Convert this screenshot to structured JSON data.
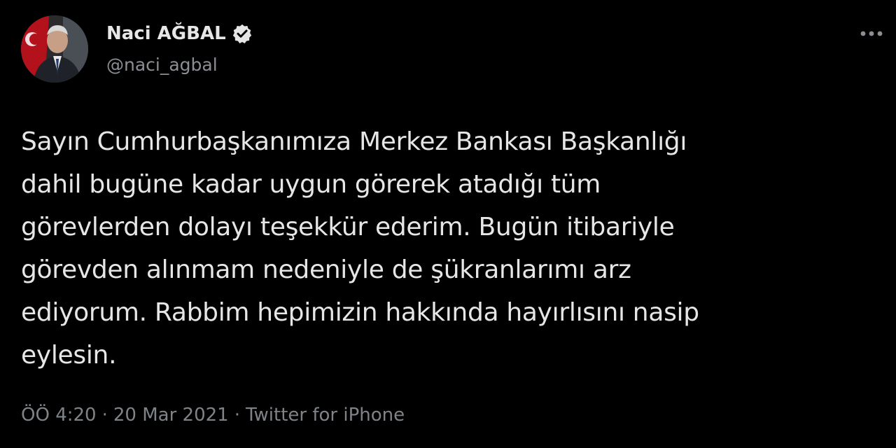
{
  "author": {
    "display_name": "Naci AĞBAL",
    "handle": "@naci_agbal",
    "verified": true,
    "avatar_icon": "profile-photo"
  },
  "tweet": {
    "text": "Sayın Cumhurbaşkanımıza Merkez Bankası Başkanlığı\ndahil bugüne kadar uygun görerek atadığı tüm\ngörevlerden dolayı teşekkür ederim. Bugün itibariyle\ngörevden alınmam nedeniyle de şükranlarımı arz\nediyorum. Rabbim hepimizin hakkında hayırlısını nasip\neylesin."
  },
  "meta": {
    "time": "ÖÖ 4:20",
    "separator": "·",
    "date": "20 Mar 2021",
    "source": "Twitter for iPhone"
  },
  "icons": {
    "verified": "verified-badge-icon",
    "more": "more-options-icon"
  },
  "colors": {
    "background": "#000000",
    "text": "#e6e6e6",
    "secondary": "#8b8f93"
  }
}
